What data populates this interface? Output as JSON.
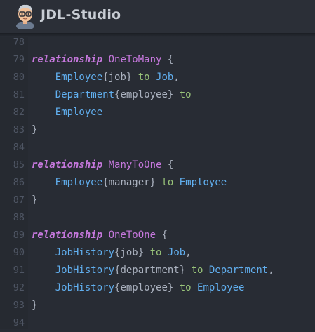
{
  "app": {
    "title": "JDL-Studio"
  },
  "editor": {
    "lines": [
      {
        "n": "78",
        "tokens": []
      },
      {
        "n": "79",
        "tokens": [
          {
            "t": "relationship",
            "c": "kw"
          },
          {
            "t": " ",
            "c": "pun"
          },
          {
            "t": "OneToMany",
            "c": "nm"
          },
          {
            "t": " {",
            "c": "pun"
          }
        ]
      },
      {
        "n": "80",
        "tokens": [
          {
            "t": "    ",
            "c": "pun"
          },
          {
            "t": "Employee",
            "c": "ent"
          },
          {
            "t": "{job}",
            "c": "fld"
          },
          {
            "t": " ",
            "c": "pun"
          },
          {
            "t": "to",
            "c": "to"
          },
          {
            "t": " ",
            "c": "pun"
          },
          {
            "t": "Job",
            "c": "ent"
          },
          {
            "t": ",",
            "c": "pun"
          }
        ]
      },
      {
        "n": "81",
        "tokens": [
          {
            "t": "    ",
            "c": "pun"
          },
          {
            "t": "Department",
            "c": "ent"
          },
          {
            "t": "{employee}",
            "c": "fld"
          },
          {
            "t": " ",
            "c": "pun"
          },
          {
            "t": "to",
            "c": "to"
          }
        ]
      },
      {
        "n": "82",
        "tokens": [
          {
            "t": "    ",
            "c": "pun"
          },
          {
            "t": "Employee",
            "c": "ent"
          }
        ]
      },
      {
        "n": "83",
        "tokens": [
          {
            "t": "}",
            "c": "pun"
          }
        ]
      },
      {
        "n": "84",
        "tokens": []
      },
      {
        "n": "85",
        "tokens": [
          {
            "t": "relationship",
            "c": "kw"
          },
          {
            "t": " ",
            "c": "pun"
          },
          {
            "t": "ManyToOne",
            "c": "nm"
          },
          {
            "t": " {",
            "c": "pun"
          }
        ]
      },
      {
        "n": "86",
        "tokens": [
          {
            "t": "    ",
            "c": "pun"
          },
          {
            "t": "Employee",
            "c": "ent"
          },
          {
            "t": "{manager}",
            "c": "fld"
          },
          {
            "t": " ",
            "c": "pun"
          },
          {
            "t": "to",
            "c": "to"
          },
          {
            "t": " ",
            "c": "pun"
          },
          {
            "t": "Employee",
            "c": "ent"
          }
        ]
      },
      {
        "n": "87",
        "tokens": [
          {
            "t": "}",
            "c": "pun"
          }
        ]
      },
      {
        "n": "88",
        "tokens": []
      },
      {
        "n": "89",
        "tokens": [
          {
            "t": "relationship",
            "c": "kw"
          },
          {
            "t": " ",
            "c": "pun"
          },
          {
            "t": "OneToOne",
            "c": "nm"
          },
          {
            "t": " {",
            "c": "pun"
          }
        ]
      },
      {
        "n": "90",
        "tokens": [
          {
            "t": "    ",
            "c": "pun"
          },
          {
            "t": "JobHistory",
            "c": "ent"
          },
          {
            "t": "{job}",
            "c": "fld"
          },
          {
            "t": " ",
            "c": "pun"
          },
          {
            "t": "to",
            "c": "to"
          },
          {
            "t": " ",
            "c": "pun"
          },
          {
            "t": "Job",
            "c": "ent"
          },
          {
            "t": ",",
            "c": "pun"
          }
        ]
      },
      {
        "n": "91",
        "tokens": [
          {
            "t": "    ",
            "c": "pun"
          },
          {
            "t": "JobHistory",
            "c": "ent"
          },
          {
            "t": "{department}",
            "c": "fld"
          },
          {
            "t": " ",
            "c": "pun"
          },
          {
            "t": "to",
            "c": "to"
          },
          {
            "t": " ",
            "c": "pun"
          },
          {
            "t": "Department",
            "c": "ent"
          },
          {
            "t": ",",
            "c": "pun"
          }
        ]
      },
      {
        "n": "92",
        "tokens": [
          {
            "t": "    ",
            "c": "pun"
          },
          {
            "t": "JobHistory",
            "c": "ent"
          },
          {
            "t": "{employee}",
            "c": "fld"
          },
          {
            "t": " ",
            "c": "pun"
          },
          {
            "t": "to",
            "c": "to"
          },
          {
            "t": " ",
            "c": "pun"
          },
          {
            "t": "Employee",
            "c": "ent"
          }
        ]
      },
      {
        "n": "93",
        "tokens": [
          {
            "t": "}",
            "c": "pun"
          }
        ]
      },
      {
        "n": "94",
        "tokens": []
      }
    ]
  },
  "colors": {
    "background": "#282c34",
    "keyword": "#c678dd",
    "entity": "#61afef",
    "to": "#98c379",
    "field": "#abb2bf",
    "line_number": "#4e5563"
  }
}
